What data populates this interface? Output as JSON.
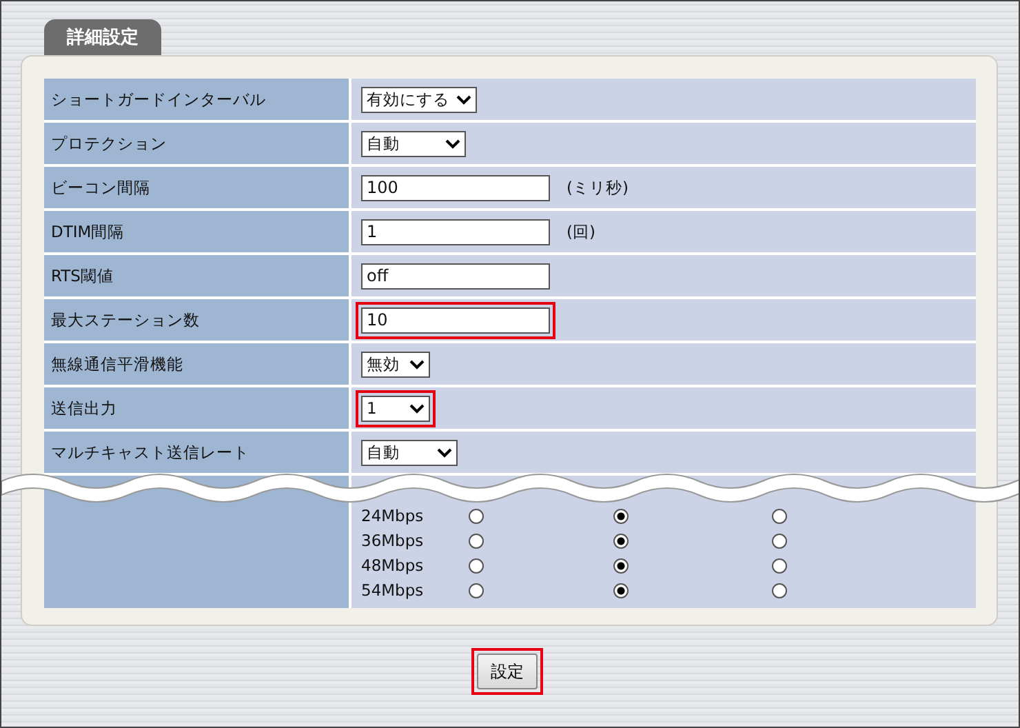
{
  "tab": {
    "label": "詳細設定"
  },
  "rows": [
    {
      "label": "ショートガードインターバル",
      "kind": "select",
      "value": "有効にする",
      "highlighted": false
    },
    {
      "label": "プロテクション",
      "kind": "select",
      "value": "自動",
      "highlighted": false
    },
    {
      "label": "ビーコン間隔",
      "kind": "input",
      "value": "100",
      "unit": "(ミリ秒)",
      "highlighted": false
    },
    {
      "label": "DTIM間隔",
      "kind": "input",
      "value": "1",
      "unit": "(回)",
      "highlighted": false
    },
    {
      "label": "RTS閾値",
      "kind": "input",
      "value": "off",
      "highlighted": false
    },
    {
      "label": "最大ステーション数",
      "kind": "input",
      "value": "10",
      "highlighted": true
    },
    {
      "label": "無線通信平滑機能",
      "kind": "select",
      "value": "無効",
      "highlighted": false
    },
    {
      "label": "送信出力",
      "kind": "select",
      "value": "1",
      "highlighted": true
    },
    {
      "label": "マルチキャスト送信レート",
      "kind": "select",
      "value": "自動",
      "highlighted": false
    }
  ],
  "rates": [
    {
      "label": "24Mbps",
      "choices": [
        {
          "selected": false
        },
        {
          "selected": true
        },
        {
          "selected": false
        }
      ]
    },
    {
      "label": "36Mbps",
      "choices": [
        {
          "selected": false
        },
        {
          "selected": true
        },
        {
          "selected": false
        }
      ]
    },
    {
      "label": "48Mbps",
      "choices": [
        {
          "selected": false
        },
        {
          "selected": true
        },
        {
          "selected": false
        }
      ]
    },
    {
      "label": "54Mbps",
      "choices": [
        {
          "selected": false
        },
        {
          "selected": true
        },
        {
          "selected": false
        }
      ]
    }
  ],
  "submit": {
    "label": "設定",
    "highlighted": true
  }
}
